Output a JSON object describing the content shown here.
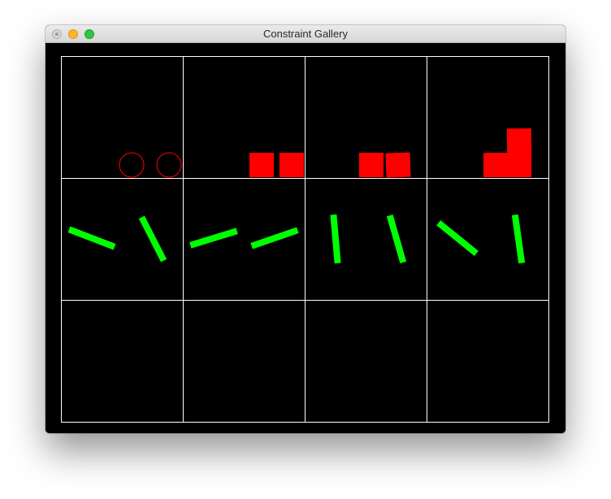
{
  "window": {
    "title": "Constraint Gallery"
  },
  "colors": {
    "background": "#000000",
    "grid": "#ffffff",
    "body_red": "#ff0000",
    "body_green": "#00ff00"
  },
  "gallery": {
    "rows": 3,
    "columns": 4,
    "cells": [
      {
        "row": 1,
        "column": 1,
        "content": "two red circle outlines"
      },
      {
        "row": 1,
        "column": 2,
        "content": "two red boxes side by side"
      },
      {
        "row": 1,
        "column": 3,
        "content": "two red boxes side by side"
      },
      {
        "row": 1,
        "column": 4,
        "content": "two red boxes stacked in L shape"
      },
      {
        "row": 2,
        "column": 1,
        "content": "two green bars"
      },
      {
        "row": 2,
        "column": 2,
        "content": "two green bars"
      },
      {
        "row": 2,
        "column": 3,
        "content": "two green bars"
      },
      {
        "row": 2,
        "column": 4,
        "content": "two green bars"
      },
      {
        "row": 3,
        "column": 1,
        "content": "empty"
      },
      {
        "row": 3,
        "column": 2,
        "content": "empty"
      },
      {
        "row": 3,
        "column": 3,
        "content": "empty"
      },
      {
        "row": 3,
        "column": 4,
        "content": "empty"
      }
    ]
  }
}
